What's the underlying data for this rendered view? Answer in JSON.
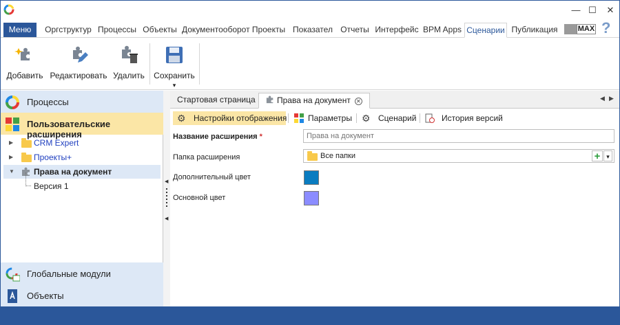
{
  "window": {
    "minimize": "—",
    "maximize": "☐",
    "close": "✕"
  },
  "menubar": {
    "menu_label": "Меню",
    "tabs": [
      "Оргструктур",
      "Процессы",
      "Объекты",
      "Документооборот",
      "Проекты",
      "Показател",
      "Отчеты",
      "Интерфейс",
      "BPM Apps",
      "Сценарии",
      "Публикация"
    ],
    "active_tab": "Сценарии",
    "badge": "MAX",
    "help": "?"
  },
  "ribbon": {
    "add": "Добавить",
    "edit": "Редактировать",
    "delete": "Удалить",
    "save": "Сохранить",
    "save_dropdown": "▾"
  },
  "sidebar": {
    "processes": "Процессы",
    "user_extensions": "Пользовательские расширения",
    "tree": {
      "crm": "CRM Expert",
      "projects": "Проекты+",
      "rights": "Права на документ",
      "version": "Версия 1"
    },
    "global_modules": "Глобальные модули",
    "objects": "Объекты"
  },
  "tabs": {
    "start": "Стартовая страница",
    "doc": "Права на документ",
    "close": "✕",
    "prev": "◀",
    "next": "▶"
  },
  "subbar": {
    "display": "Настройки отображения",
    "params": "Параметры",
    "scenario": "Сценарий",
    "history": "История версий"
  },
  "form": {
    "name_label": "Название расширения",
    "required_mark": "*",
    "name_value": "Права на документ",
    "folder_label": "Папка расширения",
    "folder_value": "Все папки",
    "extra_color_label": "Дополнительный цвет",
    "main_color_label": "Основной цвет",
    "add_plus": "+",
    "dropdown": "▾"
  },
  "colors": {
    "accent": "#2b579a",
    "extra_color": "#0a7cc0",
    "main_color": "#8b8cff",
    "selected": "#fbe6a6"
  }
}
